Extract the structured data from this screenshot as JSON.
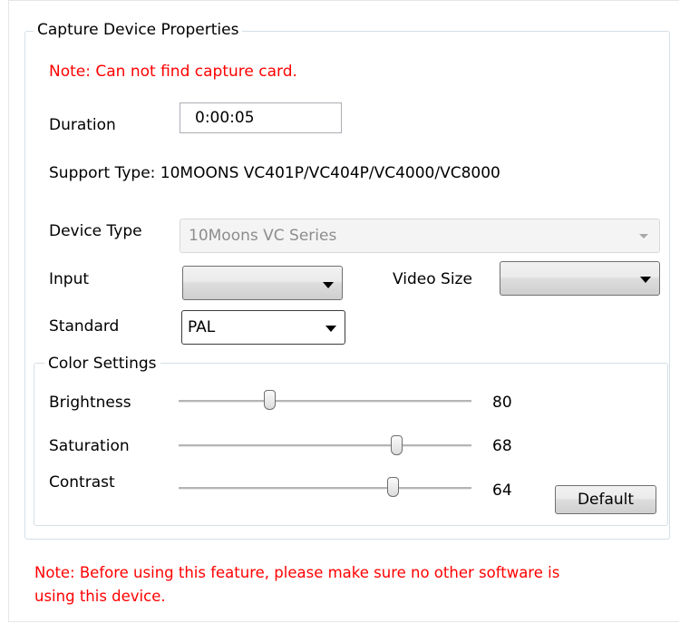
{
  "group": {
    "title": "Capture Device  Properties"
  },
  "note_top": "Note: Can not find capture card.",
  "duration": {
    "label": "Duration",
    "value": "0:00:05"
  },
  "support_type": "Support Type: 10MOONS VC401P/VC404P/VC4000/VC8000",
  "device_type": {
    "label": "Device Type",
    "value": "10Moons VC Series"
  },
  "input": {
    "label": "Input",
    "value": ""
  },
  "video_size": {
    "label": "Video Size",
    "value": ""
  },
  "standard": {
    "label": "Standard",
    "value": "PAL"
  },
  "color_settings": {
    "title": "Color Settings",
    "brightness": {
      "label": "Brightness",
      "value": "80"
    },
    "saturation": {
      "label": "Saturation",
      "value": "68"
    },
    "contrast": {
      "label": "Contrast",
      "value": "64"
    },
    "default_button": "Default"
  },
  "note_bottom_line1": "Note: Before using this feature, please make sure no other software is",
  "note_bottom_line2": "using this device."
}
